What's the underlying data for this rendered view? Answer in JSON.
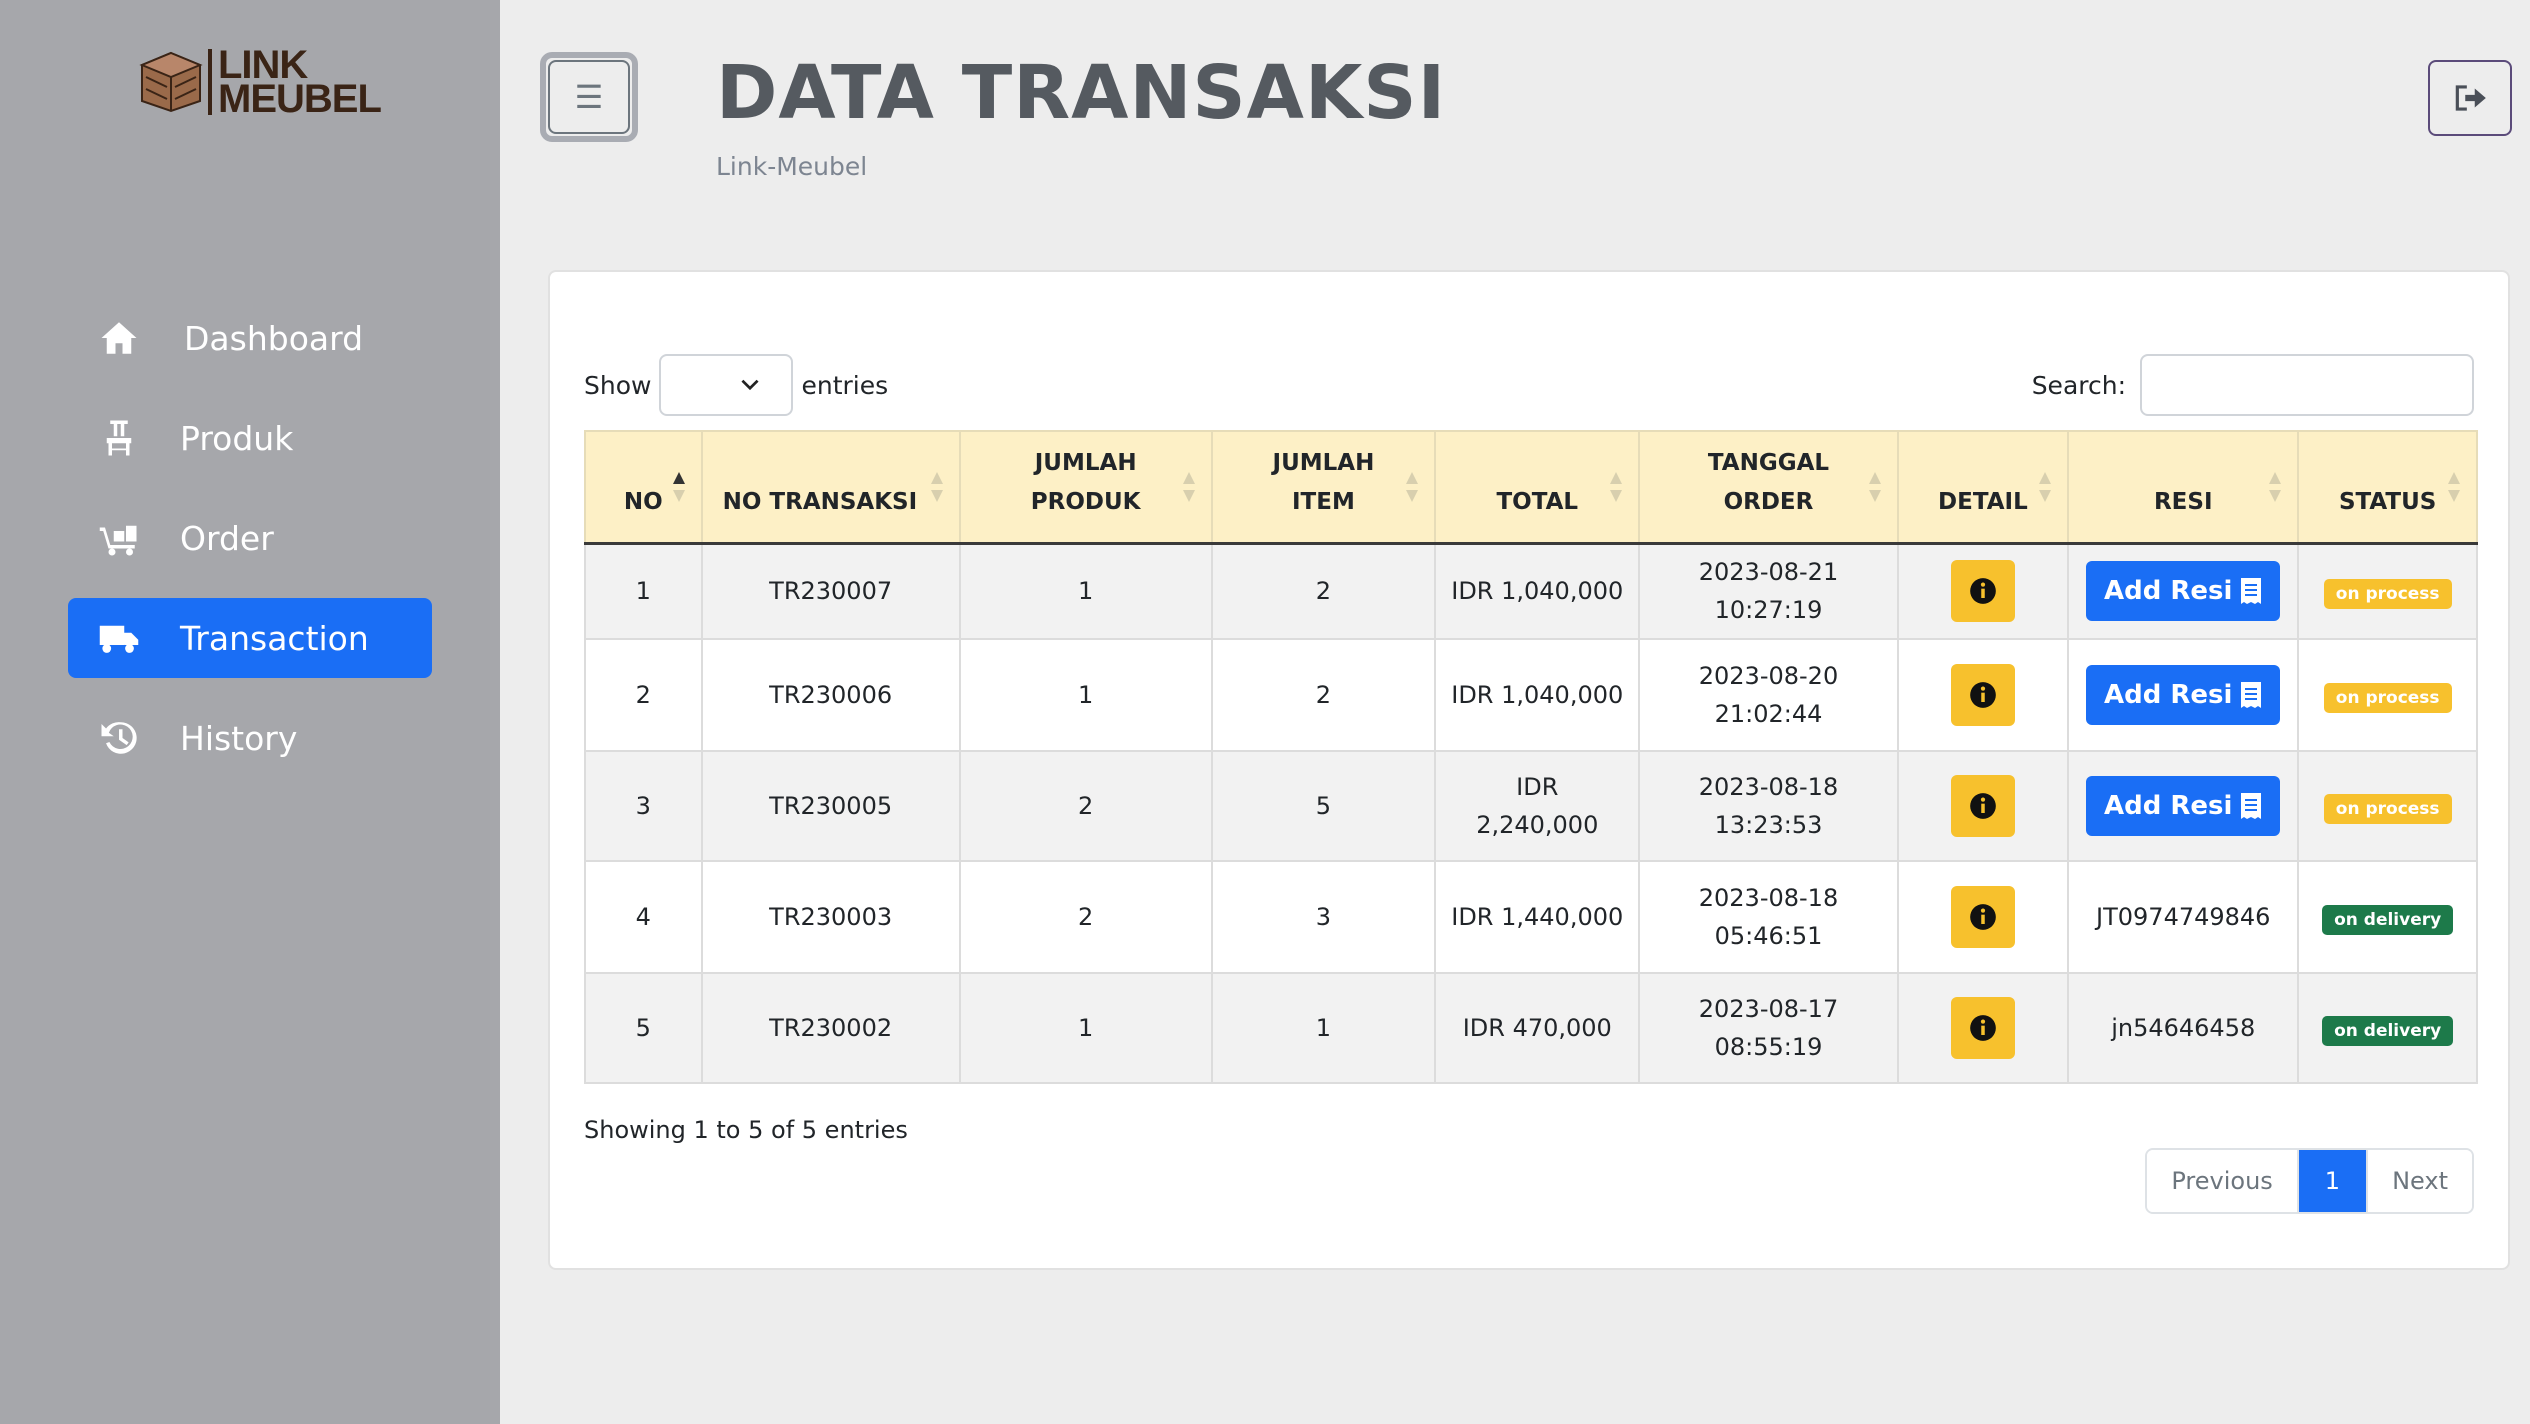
{
  "app": {
    "logo_line1": "LINK",
    "logo_line2": "MEUBEL"
  },
  "sidebar": {
    "items": [
      {
        "label": "Dashboard",
        "icon": "home-icon",
        "active": false
      },
      {
        "label": "Produk",
        "icon": "chair-icon",
        "active": false
      },
      {
        "label": "Order",
        "icon": "dolly-icon",
        "active": false
      },
      {
        "label": "Transaction",
        "icon": "truck-icon",
        "active": true
      },
      {
        "label": "History",
        "icon": "history-icon",
        "active": false
      }
    ]
  },
  "header": {
    "title": "DATA TRANSAKSI",
    "subtitle": "Link-Meubel",
    "toggle_icon": "☰",
    "logout_icon": "logout-icon"
  },
  "table_controls": {
    "show_label": "Show",
    "entries_label": "entries",
    "entries_value": "",
    "search_label": "Search:",
    "search_value": ""
  },
  "table": {
    "columns": [
      [
        "NO"
      ],
      [
        "NO TRANSAKSI"
      ],
      [
        "JUMLAH",
        "PRODUK"
      ],
      [
        "JUMLAH",
        "ITEM"
      ],
      [
        "TOTAL"
      ],
      [
        "TANGGAL",
        "ORDER"
      ],
      [
        "DETAIL"
      ],
      [
        "RESI"
      ],
      [
        "STATUS"
      ]
    ],
    "rows": [
      {
        "no": "1",
        "no_transaksi": "TR230007",
        "jumlah_produk": "1",
        "jumlah_item": "2",
        "total": "IDR 1,040,000",
        "tanggal": "2023-08-21 10:27:19",
        "resi": "Add Resi",
        "resi_is_button": true,
        "status": "on process"
      },
      {
        "no": "2",
        "no_transaksi": "TR230006",
        "jumlah_produk": "1",
        "jumlah_item": "2",
        "total": "IDR 1,040,000",
        "tanggal": "2023-08-20 21:02:44",
        "resi": "Add Resi",
        "resi_is_button": true,
        "status": "on process"
      },
      {
        "no": "3",
        "no_transaksi": "TR230005",
        "jumlah_produk": "2",
        "jumlah_item": "5",
        "total": "IDR 2,240,000",
        "tanggal": "2023-08-18 13:23:53",
        "resi": "Add Resi",
        "resi_is_button": true,
        "status": "on process"
      },
      {
        "no": "4",
        "no_transaksi": "TR230003",
        "jumlah_produk": "2",
        "jumlah_item": "3",
        "total": "IDR 1,440,000",
        "tanggal": "2023-08-18 05:46:51",
        "resi": "JT0974749846",
        "resi_is_button": false,
        "status": "on delivery"
      },
      {
        "no": "5",
        "no_transaksi": "TR230002",
        "jumlah_produk": "1",
        "jumlah_item": "1",
        "total": "IDR 470,000",
        "tanggal": "2023-08-17 08:55:19",
        "resi": "jn54646458",
        "resi_is_button": false,
        "status": "on delivery"
      }
    ]
  },
  "footer": {
    "info": "Showing 1 to 5 of 5 entries",
    "previous": "Previous",
    "current_page": "1",
    "next": "Next"
  },
  "colors": {
    "sidebar_bg": "#a6a7ab",
    "accent": "#1a6ef5",
    "header_row": "#fdf0c6",
    "warning": "#f7c12d",
    "success": "#1d7a4a"
  }
}
